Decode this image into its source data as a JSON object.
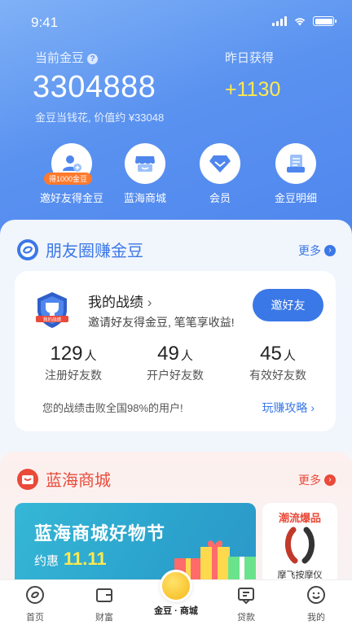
{
  "status": {
    "time": "9:41"
  },
  "header": {
    "current_label": "当前金豆",
    "current_value": "3304888",
    "yesterday_label": "昨日获得",
    "yesterday_value": "+1130",
    "subtitle": "金豆当钱花, 价值约 ¥33048"
  },
  "quick_actions": [
    {
      "label": "邀好友得金豆",
      "icon": "user-add-icon",
      "badge": "得1000金豆"
    },
    {
      "label": "蓝海商城",
      "icon": "shop-icon"
    },
    {
      "label": "会员",
      "icon": "diamond-icon"
    },
    {
      "label": "金豆明细",
      "icon": "ledger-icon"
    }
  ],
  "friends": {
    "title": "朋友圈赚金豆",
    "more": "更多",
    "card_title": "我的战绩",
    "card_desc": "邀请好友得金豆, 笔笔享收益!",
    "invite_button": "邀好友",
    "medal_text": "我的战绩",
    "stats": [
      {
        "value": "129",
        "unit": "人",
        "label": "注册好友数"
      },
      {
        "value": "49",
        "unit": "人",
        "label": "开户好友数"
      },
      {
        "value": "45",
        "unit": "人",
        "label": "有效好友数"
      }
    ],
    "beat_text": "您的战绩击败全国98%的用户!",
    "guide_link": "玩赚攻略"
  },
  "mall": {
    "title": "蓝海商城",
    "more": "更多",
    "banner_title": "蓝海商城好物节",
    "banner_prefix": "约惠",
    "banner_date": "11.11",
    "side_title": "潮流爆品",
    "side_product": "摩飞按摩仪"
  },
  "tabbar": [
    {
      "label": "首页",
      "icon": "home-icon"
    },
    {
      "label": "财富",
      "icon": "wallet-icon"
    },
    {
      "label": "金豆 · 商城",
      "icon": "coin-icon",
      "active": true
    },
    {
      "label": "贷款",
      "icon": "loan-icon"
    },
    {
      "label": "我的",
      "icon": "profile-icon"
    }
  ],
  "colors": {
    "primary": "#3b78e7",
    "hero_start": "#7fb1f6",
    "hero_end": "#4f86ee",
    "accent_yellow": "#ffe94d",
    "mall_red": "#e94a3a",
    "badge_orange": "#ff7a2e"
  }
}
